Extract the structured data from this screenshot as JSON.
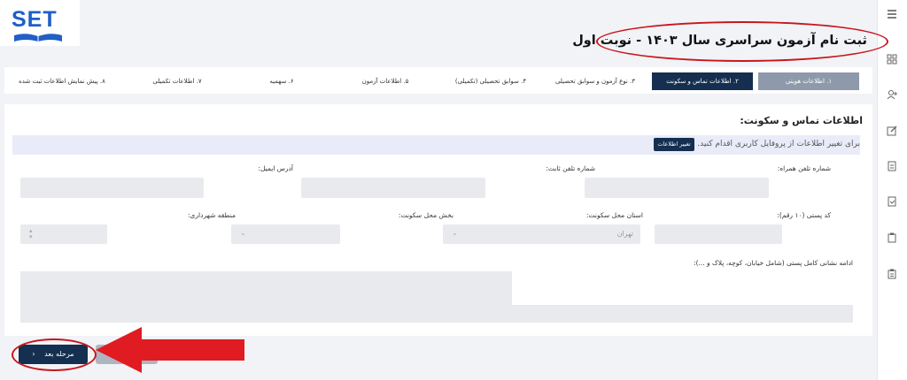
{
  "brand": {
    "logo_text": "SET"
  },
  "page": {
    "title": "ثبت نام آزمون سراسری سال ۱۴۰۳ - نوبت اول"
  },
  "steps": [
    {
      "label": "۱. اطلاعات هویتی",
      "state": "done"
    },
    {
      "label": "۲. اطلاعات تماس و سکونت",
      "state": "active"
    },
    {
      "label": "۳. نوع آزمون و سوابق تحصیلی",
      "state": "pending"
    },
    {
      "label": "۴. سوابق تحصیلی (تکمیلی)",
      "state": "pending"
    },
    {
      "label": "۵. اطلاعات آزمون",
      "state": "pending"
    },
    {
      "label": "۶. سهمیه",
      "state": "pending"
    },
    {
      "label": "۷. اطلاعات تکمیلی",
      "state": "pending"
    },
    {
      "label": "۸. پیش نمایش اطلاعات ثبت شده",
      "state": "pending"
    }
  ],
  "section": {
    "title": "اطلاعات تماس و سکونت:",
    "notice": "برای تغییر اطلاعات از پروفایل کاربری اقدام کنید.",
    "notice_button": "تغییر اطلاعات"
  },
  "fields": {
    "mobile": {
      "label": "شماره تلفن همراه:",
      "value": ""
    },
    "phone": {
      "label": "شماره تلفن ثابت:",
      "value": ""
    },
    "email": {
      "label": "آدرس ایمیل:",
      "value": ""
    },
    "postal_code": {
      "label": "کد پستی (۱۰ رقم):",
      "value": ""
    },
    "province": {
      "label": "استان محل سکونت:",
      "value": "تهران"
    },
    "district": {
      "label": "بخش محل سکونت:",
      "value": ""
    },
    "municipality": {
      "label": "منطقه شهرداری:",
      "value": ""
    },
    "address": {
      "label": "ادامه نشانی کامل پستی (شامل خیابان، کوچه، پلاک و ...):",
      "value": ""
    }
  },
  "buttons": {
    "next": "مرحله بعد",
    "prev": "مرحله قبل"
  },
  "colors": {
    "primary": "#142f4f",
    "done": "#8e9aab",
    "annotation": "#c8161d",
    "brand": "#1f5fc7"
  },
  "icons": [
    "hamburger-menu-icon",
    "grid-icon",
    "add-user-icon",
    "edit-icon",
    "document-icon",
    "clipboard-icon",
    "chevron-left-icon",
    "chevron-down-icon",
    "arrow-annotation-icon"
  ]
}
